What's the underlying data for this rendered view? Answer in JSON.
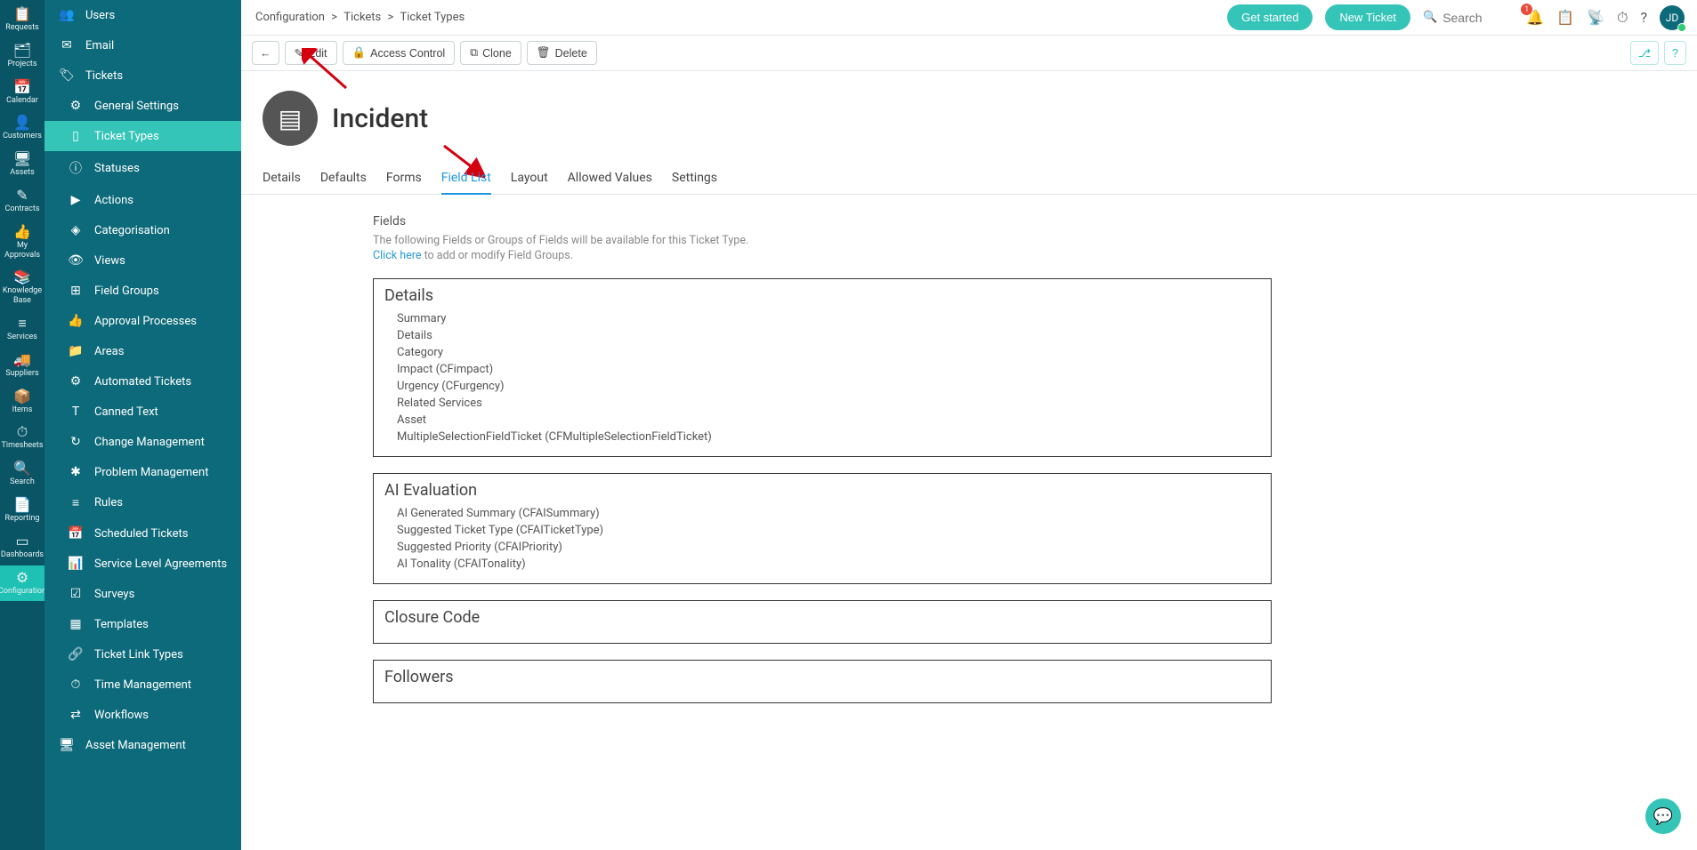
{
  "navRail": [
    {
      "icon": "📋",
      "label": "Requests",
      "name": "nav-requests"
    },
    {
      "icon": "🗂",
      "label": "Projects",
      "name": "nav-projects"
    },
    {
      "icon": "📅",
      "label": "Calendar",
      "name": "nav-calendar"
    },
    {
      "icon": "👤",
      "label": "Customers",
      "name": "nav-customers"
    },
    {
      "icon": "🖥",
      "label": "Assets",
      "name": "nav-assets"
    },
    {
      "icon": "✎",
      "label": "Contracts",
      "name": "nav-contracts"
    },
    {
      "icon": "👍",
      "label": "My Approvals",
      "name": "nav-approvals"
    },
    {
      "icon": "📚",
      "label": "Knowledge Base",
      "name": "nav-kb"
    },
    {
      "icon": "≡",
      "label": "Services",
      "name": "nav-services"
    },
    {
      "icon": "🚚",
      "label": "Suppliers",
      "name": "nav-suppliers"
    },
    {
      "icon": "📦",
      "label": "Items",
      "name": "nav-items"
    },
    {
      "icon": "⏱",
      "label": "Timesheets",
      "name": "nav-timesheets"
    },
    {
      "icon": "🔍",
      "label": "Search",
      "name": "nav-search"
    },
    {
      "icon": "📄",
      "label": "Reporting",
      "name": "nav-reporting"
    },
    {
      "icon": "▭",
      "label": "Dashboards",
      "name": "nav-dashboards"
    },
    {
      "icon": "⚙",
      "label": "Configuration",
      "name": "nav-configuration",
      "active": true
    }
  ],
  "sidebar": [
    {
      "icon": "👥",
      "label": "Users",
      "name": "side-users"
    },
    {
      "icon": "✉",
      "label": "Email",
      "name": "side-email"
    },
    {
      "icon": "🏷",
      "label": "Tickets",
      "name": "side-tickets"
    },
    {
      "icon": "⚙",
      "label": "General Settings",
      "name": "side-general",
      "sub": true
    },
    {
      "icon": "▯",
      "label": "Ticket Types",
      "name": "side-ticket-types",
      "sub": true,
      "active": true
    },
    {
      "icon": "ⓘ",
      "label": "Statuses",
      "name": "side-statuses",
      "sub": true
    },
    {
      "icon": "▶",
      "label": "Actions",
      "name": "side-actions",
      "sub": true
    },
    {
      "icon": "◈",
      "label": "Categorisation",
      "name": "side-categorisation",
      "sub": true
    },
    {
      "icon": "👁",
      "label": "Views",
      "name": "side-views",
      "sub": true
    },
    {
      "icon": "⊞",
      "label": "Field Groups",
      "name": "side-field-groups",
      "sub": true
    },
    {
      "icon": "👍",
      "label": "Approval Processes",
      "name": "side-approval",
      "sub": true
    },
    {
      "icon": "📁",
      "label": "Areas",
      "name": "side-areas",
      "sub": true
    },
    {
      "icon": "⚙",
      "label": "Automated Tickets",
      "name": "side-automated",
      "sub": true
    },
    {
      "icon": "T",
      "label": "Canned Text",
      "name": "side-canned",
      "sub": true
    },
    {
      "icon": "↻",
      "label": "Change Management",
      "name": "side-change",
      "sub": true
    },
    {
      "icon": "✱",
      "label": "Problem Management",
      "name": "side-problem",
      "sub": true
    },
    {
      "icon": "≡",
      "label": "Rules",
      "name": "side-rules",
      "sub": true
    },
    {
      "icon": "📅",
      "label": "Scheduled Tickets",
      "name": "side-scheduled",
      "sub": true
    },
    {
      "icon": "📊",
      "label": "Service Level Agreements",
      "name": "side-sla",
      "sub": true
    },
    {
      "icon": "☑",
      "label": "Surveys",
      "name": "side-surveys",
      "sub": true
    },
    {
      "icon": "▦",
      "label": "Templates",
      "name": "side-templates",
      "sub": true
    },
    {
      "icon": "🔗",
      "label": "Ticket Link Types",
      "name": "side-link-types",
      "sub": true
    },
    {
      "icon": "⏱",
      "label": "Time Management",
      "name": "side-time",
      "sub": true
    },
    {
      "icon": "⇄",
      "label": "Workflows",
      "name": "side-workflows",
      "sub": true
    },
    {
      "icon": "🖥",
      "label": "Asset Management",
      "name": "side-asset-mgmt"
    }
  ],
  "breadcrumb": [
    "Configuration",
    "Tickets",
    "Ticket Types"
  ],
  "topbar": {
    "getStarted": "Get started",
    "newTicket": "New Ticket",
    "searchPlaceholder": "Search",
    "notifBadge": "1",
    "avatarInitials": "JD"
  },
  "actionbar": {
    "back": "←",
    "edit": "Edit",
    "accessControl": "Access Control",
    "clone": "Clone",
    "delete": "Delete"
  },
  "page": {
    "title": "Incident"
  },
  "tabs": [
    "Details",
    "Defaults",
    "Forms",
    "Field List",
    "Layout",
    "Allowed Values",
    "Settings"
  ],
  "activeTab": "Field List",
  "fieldSection": {
    "heading": "Fields",
    "desc": "The following Fields or Groups of Fields will be available for this Ticket Type.",
    "linkText": "Click here",
    "linkSuffix": " to add or modify Field Groups."
  },
  "groups": [
    {
      "title": "Details",
      "fields": [
        "Summary",
        "Details",
        "Category",
        "Impact (CFimpact)",
        "Urgency (CFurgency)",
        "Related Services",
        "Asset",
        "MultipleSelectionFieldTicket (CFMultipleSelectionFieldTicket)"
      ]
    },
    {
      "title": "AI Evaluation",
      "fields": [
        "AI Generated Summary (CFAISummary)",
        "Suggested Ticket Type (CFAITicketType)",
        "Suggested Priority (CFAIPriority)",
        "AI Tonality (CFAITonality)"
      ]
    },
    {
      "title": "Closure Code",
      "fields": []
    },
    {
      "title": "Followers",
      "fields": []
    }
  ]
}
